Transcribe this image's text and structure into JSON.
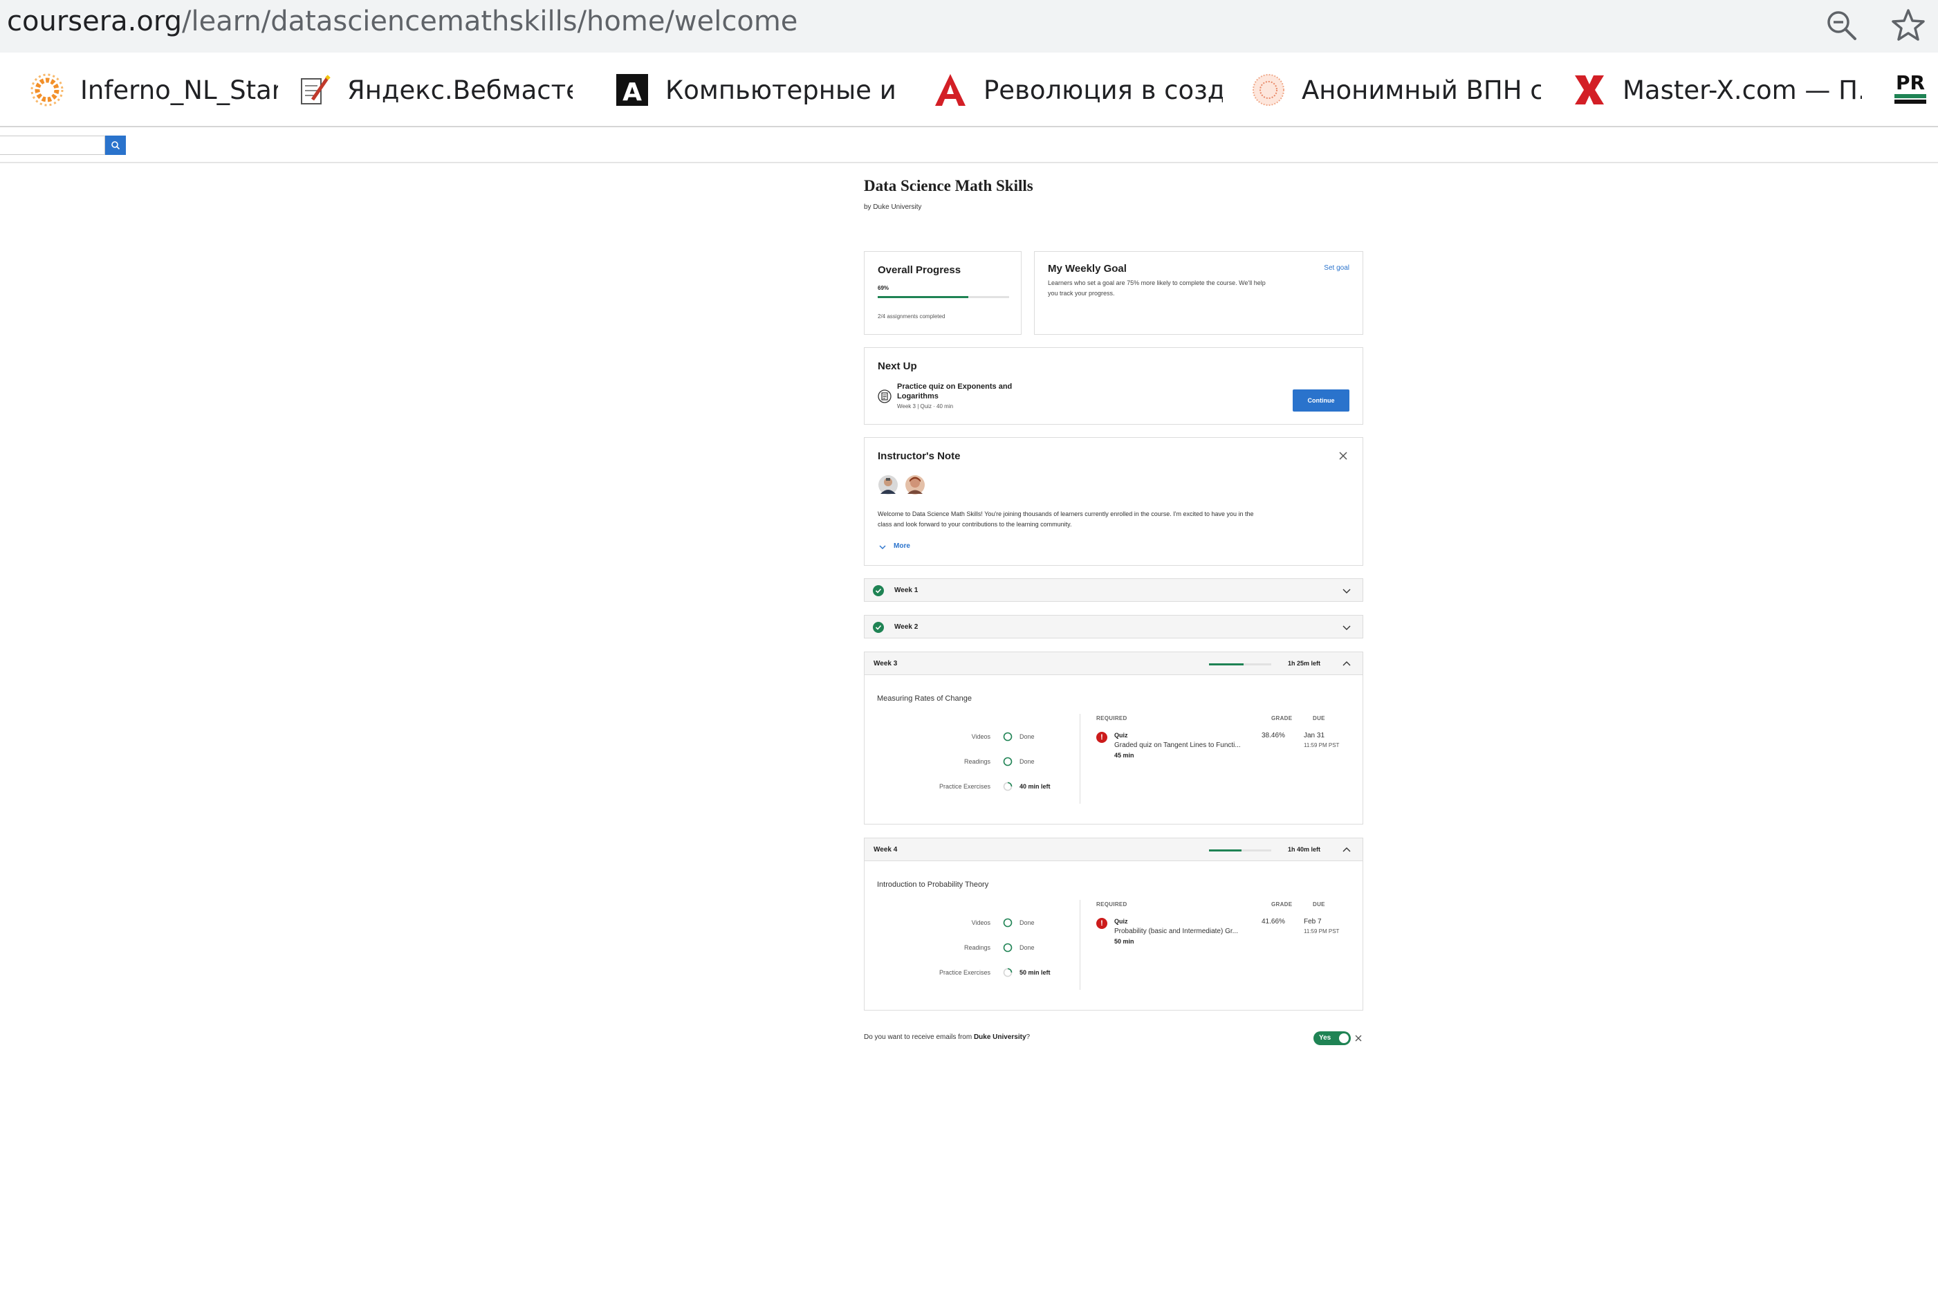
{
  "browser": {
    "url_host": "coursera.org",
    "url_path": "/learn/datasciencemathskills/home/welcome",
    "bookmarks": [
      {
        "label": "Inferno_NL_Start",
        "icon": "sun-icon"
      },
      {
        "label": "Яндекс.Вебмастер...",
        "icon": "notepad-icon"
      },
      {
        "label": "Компьютерные иг...",
        "icon": "a-logo-icon"
      },
      {
        "label": "Революция в созд...",
        "icon": "red-a-icon"
      },
      {
        "label": "Анонимный ВПН с...",
        "icon": "sphere-icon"
      },
      {
        "label": "Master-X.com — П...",
        "icon": "red-x-icon"
      },
      {
        "label": "PR",
        "icon": "pr-icon"
      }
    ]
  },
  "course": {
    "title": "Data Science Math Skills",
    "by": "by Duke University"
  },
  "overall_progress": {
    "title": "Overall Progress",
    "percent_label": "69%",
    "fraction": 0.69,
    "assignments": "2/4 assignments completed"
  },
  "weekly_goal": {
    "title": "My Weekly Goal",
    "set_goal": "Set goal",
    "text_line1": "Learners who set a goal are 75% more likely to complete the course. We'll help",
    "text_line2": "you track your progress."
  },
  "next_up": {
    "title": "Next Up",
    "item_line1": "Practice quiz on Exponents and",
    "item_line2": "Logarithms",
    "meta": "Week 3 | Quiz · 40 min",
    "button": "Continue"
  },
  "instructor_note": {
    "title": "Instructor's Note",
    "text_line1": "Welcome to Data Science Math Skills! You're joining thousands of learners currently enrolled in the course. I'm excited to have you in the",
    "text_line2": "class and look forward to your contributions to the learning community.",
    "more": "More"
  },
  "weeks_collapsed": [
    {
      "label": "Week 1"
    },
    {
      "label": "Week 2"
    }
  ],
  "weeks_expanded": [
    {
      "label": "Week 3",
      "progress": 0.55,
      "time_left": "1h 25m left",
      "module": "Measuring Rates of Change",
      "rows": [
        {
          "label": "Videos",
          "status": "Done"
        },
        {
          "label": "Readings",
          "status": "Done"
        },
        {
          "label": "Practice Exercises",
          "status": "40 min left"
        }
      ],
      "col_required": "REQUIRED",
      "col_grade": "GRADE",
      "col_due": "DUE",
      "quiz_type": "Quiz",
      "quiz_name": "Graded quiz on Tangent Lines to Functi...",
      "quiz_time": "45 min",
      "grade": "38.46%",
      "due_date": "Jan 31",
      "due_time": "11:59 PM PST"
    },
    {
      "label": "Week 4",
      "progress": 0.52,
      "time_left": "1h 40m left",
      "module": "Introduction to Probability Theory",
      "rows": [
        {
          "label": "Videos",
          "status": "Done"
        },
        {
          "label": "Readings",
          "status": "Done"
        },
        {
          "label": "Practice Exercises",
          "status": "50 min left"
        }
      ],
      "col_required": "REQUIRED",
      "col_grade": "GRADE",
      "col_due": "DUE",
      "quiz_type": "Quiz",
      "quiz_name": "Probability (basic and Intermediate) Gr...",
      "quiz_time": "50 min",
      "grade": "41.66%",
      "due_date": "Feb 7",
      "due_time": "11:59 PM PST"
    }
  ],
  "email_prompt": {
    "text_prefix": "Do you want to receive emails from ",
    "university": "Duke University",
    "text_suffix": "?",
    "toggle_label": "Yes"
  },
  "colors": {
    "accent_blue": "#2a73cc",
    "success_green": "#1f8354",
    "alert_red": "#cc1b1b"
  }
}
